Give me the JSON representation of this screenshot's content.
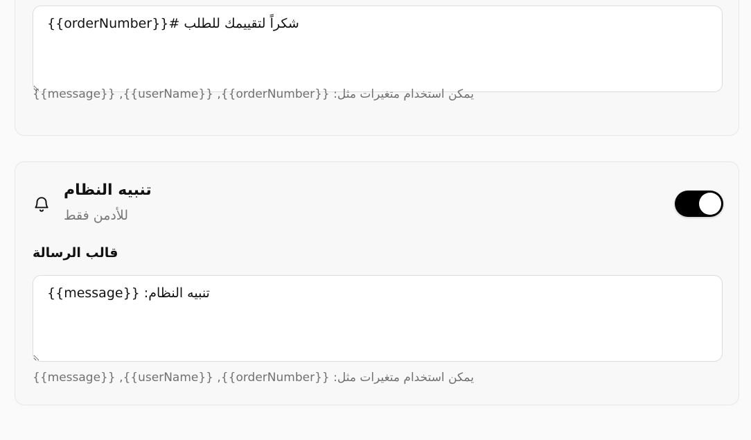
{
  "top_card": {
    "template_value": "شكراً لتقييمك للطلب #{{orderNumber}}",
    "hint": "يمكن استخدام متغيرات مثل: {{orderNumber}}, {{userName}}, {{message}}"
  },
  "system_card": {
    "icon": "bell-icon",
    "title": "تنبيه النظام",
    "subtitle": "للأدمن فقط",
    "toggle_on": true,
    "template_label": "قالب الرسالة",
    "template_value": "تنبيه النظام: {{message}}",
    "hint": "يمكن استخدام متغيرات مثل: {{orderNumber}}, {{userName}}, {{message}}"
  }
}
